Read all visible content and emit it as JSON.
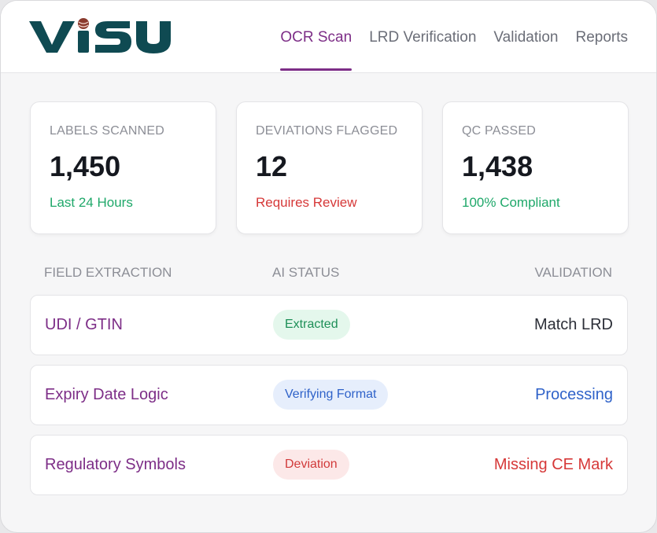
{
  "brand": {
    "logo_text": "VISU"
  },
  "nav": {
    "tabs": [
      {
        "label": "OCR Scan",
        "active": true
      },
      {
        "label": "LRD Verification",
        "active": false
      },
      {
        "label": "Validation",
        "active": false
      },
      {
        "label": "Reports",
        "active": false
      }
    ]
  },
  "stats": [
    {
      "label": "LABELS SCANNED",
      "value": "1,450",
      "sub": "Last 24 Hours",
      "sub_color": "#1fa86a"
    },
    {
      "label": "DEVIATIONS FLAGGED",
      "value": "12",
      "sub": "Requires Review",
      "sub_color": "#d63838"
    },
    {
      "label": "QC PASSED",
      "value": "1,438",
      "sub": "100% Compliant",
      "sub_color": "#1fa86a"
    }
  ],
  "table": {
    "headers": {
      "field": "FIELD EXTRACTION",
      "status": "AI STATUS",
      "validation": "VALIDATION"
    },
    "rows": [
      {
        "field": "UDI / GTIN",
        "status": "Extracted",
        "validation": "Match LRD"
      },
      {
        "field": "Expiry Date Logic",
        "status": "Verifying Format",
        "validation": "Processing"
      },
      {
        "field": "Regulatory Symbols",
        "status": "Deviation",
        "validation": "Missing CE Mark"
      }
    ]
  },
  "colors": {
    "brand_teal": "#0f4a52",
    "accent_purple": "#7d2e87",
    "success_green": "#1fa86a",
    "danger_red": "#d63838",
    "info_blue": "#2f62c9"
  }
}
